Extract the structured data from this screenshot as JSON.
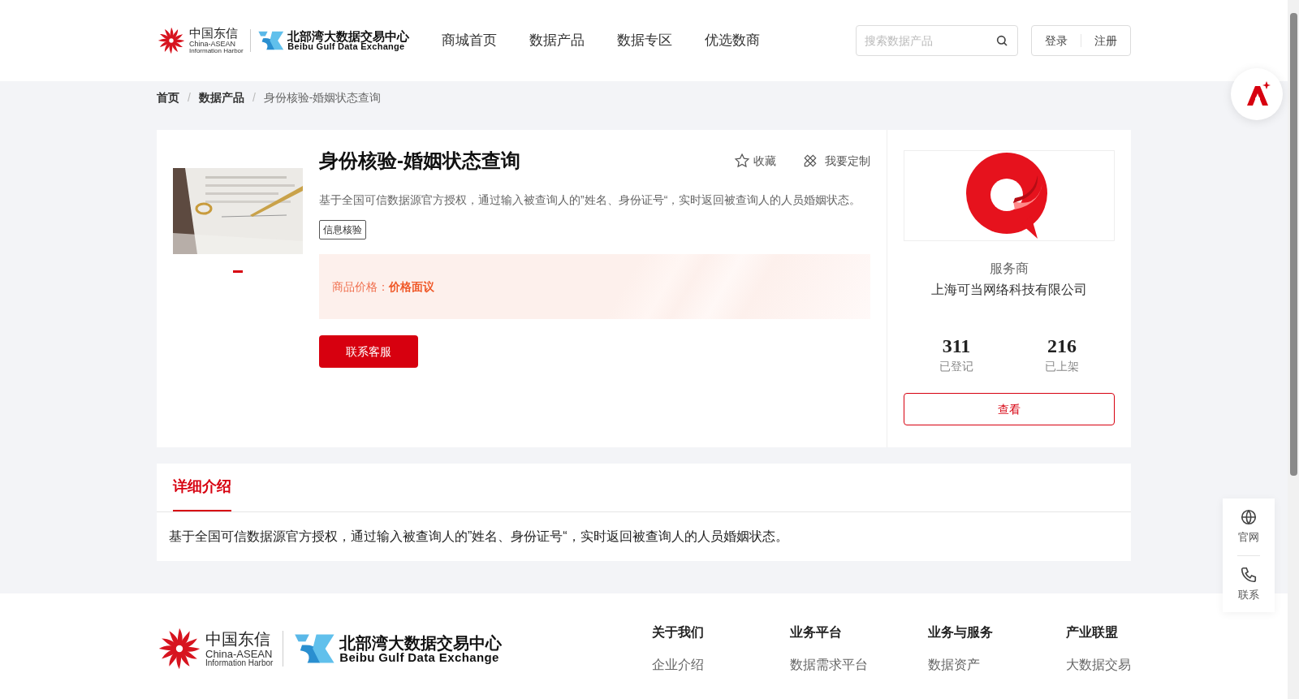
{
  "header": {
    "logo_cn": "中国东信",
    "logo_en1": "China-ASEAN",
    "logo_en2": "Information Harbor",
    "logo2_cn": "北部湾大数据交易中心",
    "logo2_en": "Beibu Gulf Data Exchange",
    "nav": [
      {
        "label": "商城首页",
        "selected": false
      },
      {
        "label": "数据产品",
        "selected": false
      },
      {
        "label": "数据专区",
        "selected": false
      },
      {
        "label": "优选数商",
        "selected": false
      }
    ],
    "search": {
      "placeholder": "搜索数据产品"
    },
    "login": "登录",
    "register": "注册"
  },
  "breadcrumb": [
    {
      "label": "首页",
      "kind": "link"
    },
    {
      "label": "/",
      "kind": "separator"
    },
    {
      "label": "数据产品",
      "kind": "link"
    },
    {
      "label": "/",
      "kind": "separator"
    },
    {
      "label": "身份核验-婚姻状态查询",
      "kind": "current"
    }
  ],
  "product": {
    "title": "身份核验-婚姻状态查询",
    "favorite": "收藏",
    "customize": "我要定制",
    "description": "基于全国可信数据源官方授权，通过输入被查询人的”姓名、身份证号“，实时返回被查询人的人员婚姻状态。",
    "tags": [
      "信息核验"
    ],
    "price_label": "商品价格：",
    "price_value": "价格面议",
    "contact_button": "联系客服",
    "carousel": [
      {
        "selected": true
      }
    ]
  },
  "provider": {
    "role": "服务商",
    "name": "上海可当网络科技有限公司",
    "stats": [
      {
        "value": "311",
        "label": "已登记"
      },
      {
        "value": "216",
        "label": "已上架"
      }
    ],
    "view_button": "查看"
  },
  "detail": {
    "tabs": [
      {
        "label": "详细介绍",
        "selected": true
      }
    ],
    "text": "基于全国可信数据源官方授权，通过输入被查询人的”姓名、身份证号“，实时返回被查询人的人员婚姻状态。"
  },
  "side_panel": [
    {
      "label": "官网",
      "kind": "globe"
    },
    {
      "label": "联系",
      "kind": "phone"
    }
  ],
  "footer": {
    "logo": {
      "logo_cn": "中国东信",
      "logo_en1": "China-ASEAN",
      "logo_en2": "Information Harbor",
      "logo2_cn": "北部湾大数据交易中心",
      "logo2_en": "Beibu Gulf Data Exchange"
    },
    "columns": [
      {
        "title": "关于我们",
        "items": [
          "企业介绍"
        ]
      },
      {
        "title": "业务平台",
        "items": [
          "数据需求平台"
        ]
      },
      {
        "title": "业务与服务",
        "items": [
          "数据资产"
        ]
      },
      {
        "title": "产业联盟",
        "items": [
          "大数据交易"
        ]
      }
    ]
  }
}
